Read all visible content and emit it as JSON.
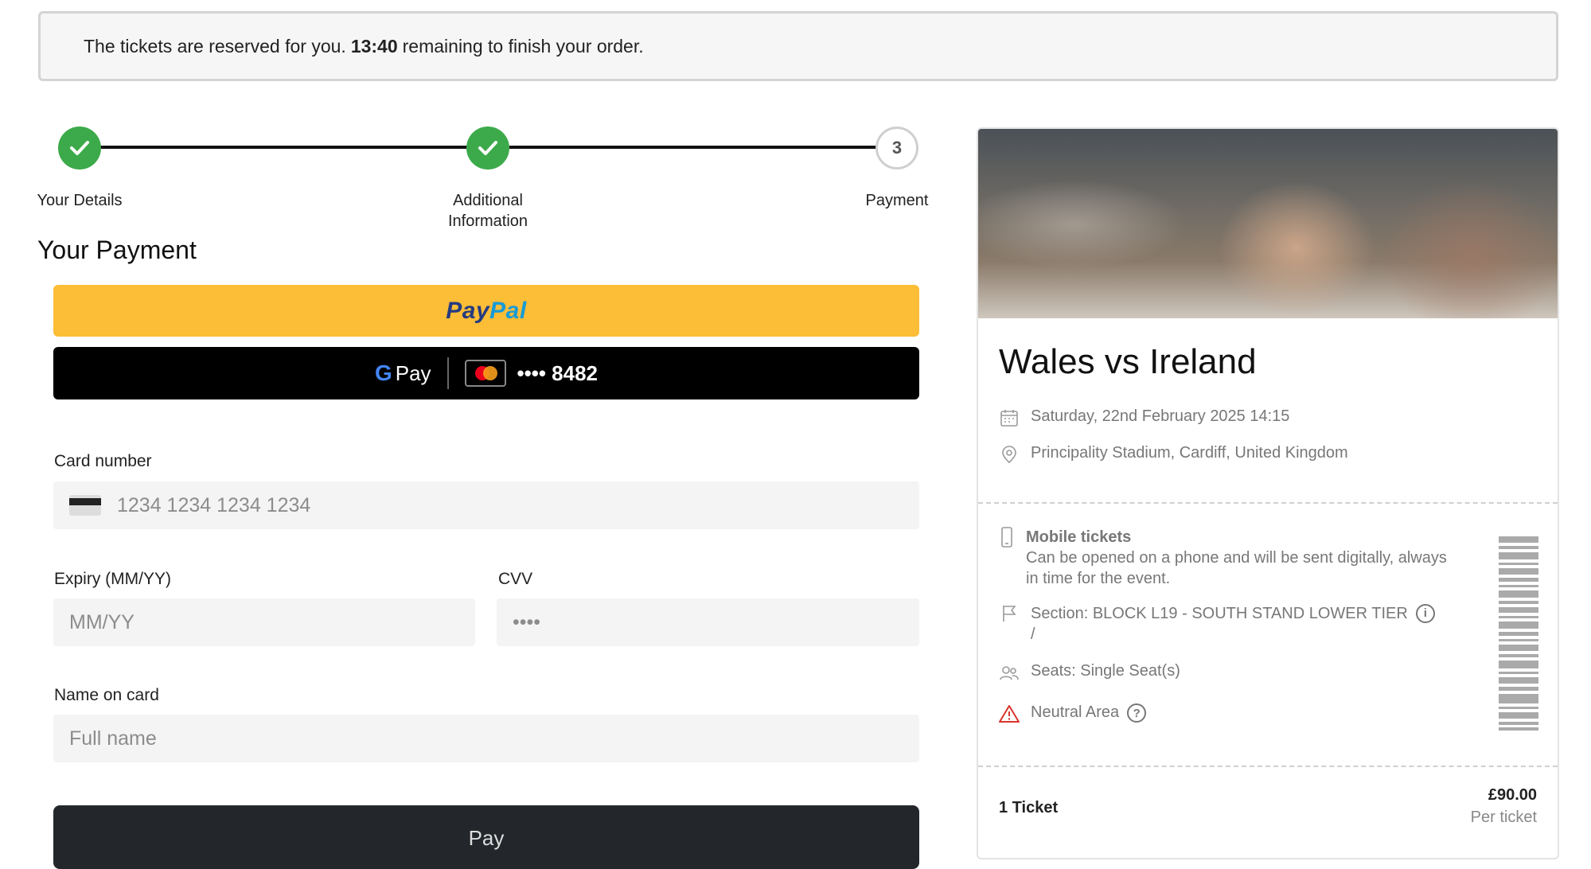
{
  "banner": {
    "prefix": "The tickets are reserved for you.",
    "time": "13:40",
    "suffix": "remaining to finish your order."
  },
  "stepper": {
    "steps": [
      {
        "label": "Your Details",
        "status": "complete"
      },
      {
        "label": "Additional Information",
        "status": "complete"
      },
      {
        "label": "Payment",
        "status": "current",
        "number": "3"
      }
    ]
  },
  "payment": {
    "title": "Your Payment",
    "paypal": {
      "part1": "Pay",
      "part2": "Pal"
    },
    "gpay": {
      "label_g": "G",
      "label": "Pay",
      "card": "•••• 8482"
    },
    "card_number": {
      "label": "Card number",
      "placeholder": "1234 1234 1234 1234"
    },
    "expiry": {
      "label": "Expiry (MM/YY)",
      "placeholder": "MM/YY"
    },
    "cvv": {
      "label": "CVV",
      "placeholder": "••••"
    },
    "name": {
      "label": "Name on card",
      "placeholder": "Full name"
    },
    "pay_button": "Pay"
  },
  "event": {
    "title": "Wales vs Ireland",
    "date": "Saturday, 22nd February 2025 14:15",
    "venue": "Principality Stadium, Cardiff, United Kingdom",
    "ticket_type_title": "Mobile tickets",
    "ticket_type_desc": "Can be opened on a phone and will be sent digitally, always in time for the event.",
    "section": "Section: BLOCK L19 - SOUTH STAND LOWER TIER",
    "section_suffix": "/",
    "seats": "Seats: Single Seat(s)",
    "area": "Neutral Area",
    "quantity": "1 Ticket",
    "price": "£90.00",
    "price_note": "Per ticket"
  },
  "colors": {
    "success": "#3caa4a",
    "paypal_yellow": "#fcbd37",
    "warning_red": "#d9342b"
  }
}
